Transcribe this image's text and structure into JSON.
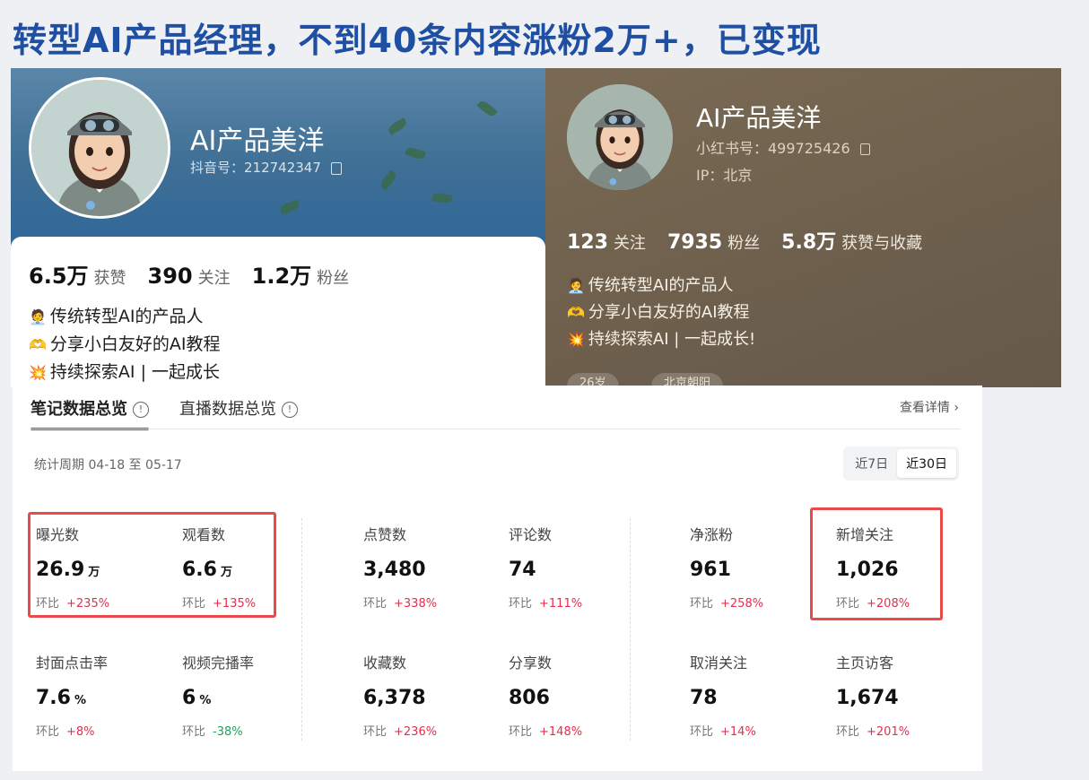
{
  "headline": "转型AI产品经理，不到40条内容涨粉2万+，已变现",
  "douyin": {
    "name": "AI产品美洋",
    "id_text": "抖音号：212742347",
    "stats": [
      {
        "num": "6.5万",
        "label": "获赞"
      },
      {
        "num": "390",
        "label": "关注"
      },
      {
        "num": "1.2万",
        "label": "粉丝"
      }
    ],
    "bio": [
      {
        "emoji": "🧑‍💼",
        "text": "传统转型AI的产品人"
      },
      {
        "emoji": "🫶",
        "text": "分享小白友好的AI教程"
      },
      {
        "emoji": "💥",
        "text": "持续探索AI | 一起成长"
      }
    ]
  },
  "xhs": {
    "name": "AI产品美洋",
    "id_text": "小红书号：499725426",
    "ip_text": "IP：北京",
    "stats": [
      {
        "num": "123",
        "label": "关注"
      },
      {
        "num": "7935",
        "label": "粉丝"
      },
      {
        "num": "5.8万",
        "label": "获赞与收藏"
      }
    ],
    "bio": [
      {
        "emoji": "🧑‍💼",
        "text": "传统转型AI的产品人"
      },
      {
        "emoji": "🫶",
        "text": "分享小白友好的AI教程"
      },
      {
        "emoji": "💥",
        "text": "持续探索AI | 一起成长!"
      }
    ],
    "chips": [
      "26岁",
      "北京朝阳"
    ]
  },
  "panel": {
    "tabs": [
      "笔记数据总览",
      "直播数据总览"
    ],
    "info_glyph": "!",
    "detail_link": "查看详情 ›",
    "period": "统计周期 04-18 至 05-17",
    "ranges": [
      "近7日",
      "近30日"
    ],
    "change_label": "环比",
    "metrics": [
      {
        "label": "曝光数",
        "value": "26.9",
        "unit": "万",
        "change": "+235%"
      },
      {
        "label": "观看数",
        "value": "6.6",
        "unit": "万",
        "change": "+135%"
      },
      {
        "label": "点赞数",
        "value": "3,480",
        "unit": "",
        "change": "+338%"
      },
      {
        "label": "评论数",
        "value": "74",
        "unit": "",
        "change": "+111%"
      },
      {
        "label": "净涨粉",
        "value": "961",
        "unit": "",
        "change": "+258%"
      },
      {
        "label": "新增关注",
        "value": "1,026",
        "unit": "",
        "change": "+208%"
      },
      {
        "label": "封面点击率",
        "value": "7.6",
        "unit": "%",
        "change": "+8%"
      },
      {
        "label": "视频完播率",
        "value": "6",
        "unit": "%",
        "change": "-38%"
      },
      {
        "label": "收藏数",
        "value": "6,378",
        "unit": "",
        "change": "+236%"
      },
      {
        "label": "分享数",
        "value": "806",
        "unit": "",
        "change": "+148%"
      },
      {
        "label": "取消关注",
        "value": "78",
        "unit": "",
        "change": "+14%"
      },
      {
        "label": "主页访客",
        "value": "1,674",
        "unit": "",
        "change": "+201%"
      }
    ]
  },
  "colors": {
    "headline": "#1f4fa3",
    "positive": "#e0304f",
    "negative": "#22a05a",
    "highlight": "#e94b4b",
    "tab_accent": "#3b5ccc"
  }
}
